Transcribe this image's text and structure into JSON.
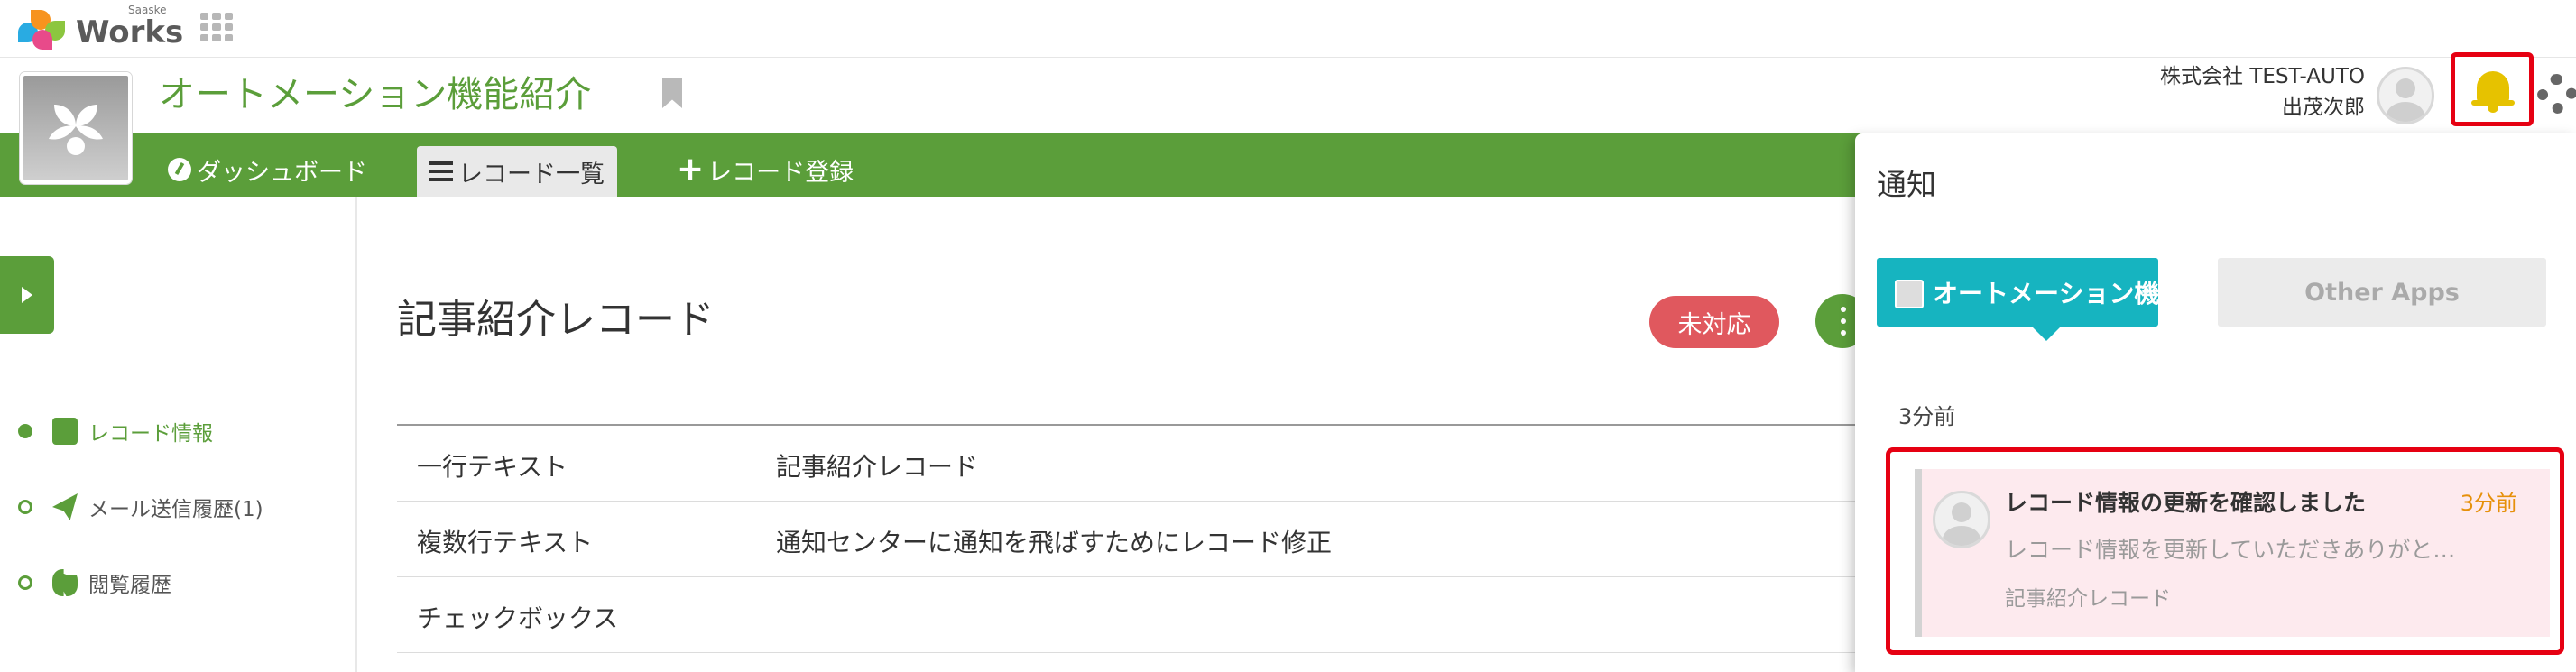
{
  "brand": {
    "sub": "Saaske",
    "name": "Works"
  },
  "app": {
    "title": "オートメーション機能紹介"
  },
  "user": {
    "company": "株式会社 TEST-AUTO",
    "name": "出茂次郎"
  },
  "nav": {
    "tabs": [
      {
        "label": "ダッシュボード"
      },
      {
        "label": "レコード一覧"
      },
      {
        "label": "レコード登録"
      }
    ]
  },
  "sidebar": {
    "items": [
      {
        "label": "レコード情報"
      },
      {
        "label": "メール送信履歴(1)"
      },
      {
        "label": "閲覧履歴"
      }
    ]
  },
  "record": {
    "title": "記事紹介レコード",
    "status": "未対応",
    "fields": [
      {
        "label": "一行テキスト",
        "value": "記事紹介レコード"
      },
      {
        "label": "複数行テキスト",
        "value": "通知センターに通知を飛ばすためにレコード修正"
      },
      {
        "label": "チェックボックス",
        "value": ""
      }
    ]
  },
  "notifications": {
    "title": "通知",
    "tab_current": "オートメーション機…",
    "tab_other": "Other Apps",
    "group_time": "3分前",
    "items": [
      {
        "headline": "レコード情報の更新を確認しました",
        "time": "3分前",
        "body": "レコード情報を更新していただきありがと…",
        "record": "記事紹介レコード"
      }
    ]
  },
  "colors": {
    "accent": "#5b9e3a",
    "teal": "#16b4c0",
    "status_red": "#e0585e",
    "highlight": "#e60012"
  }
}
